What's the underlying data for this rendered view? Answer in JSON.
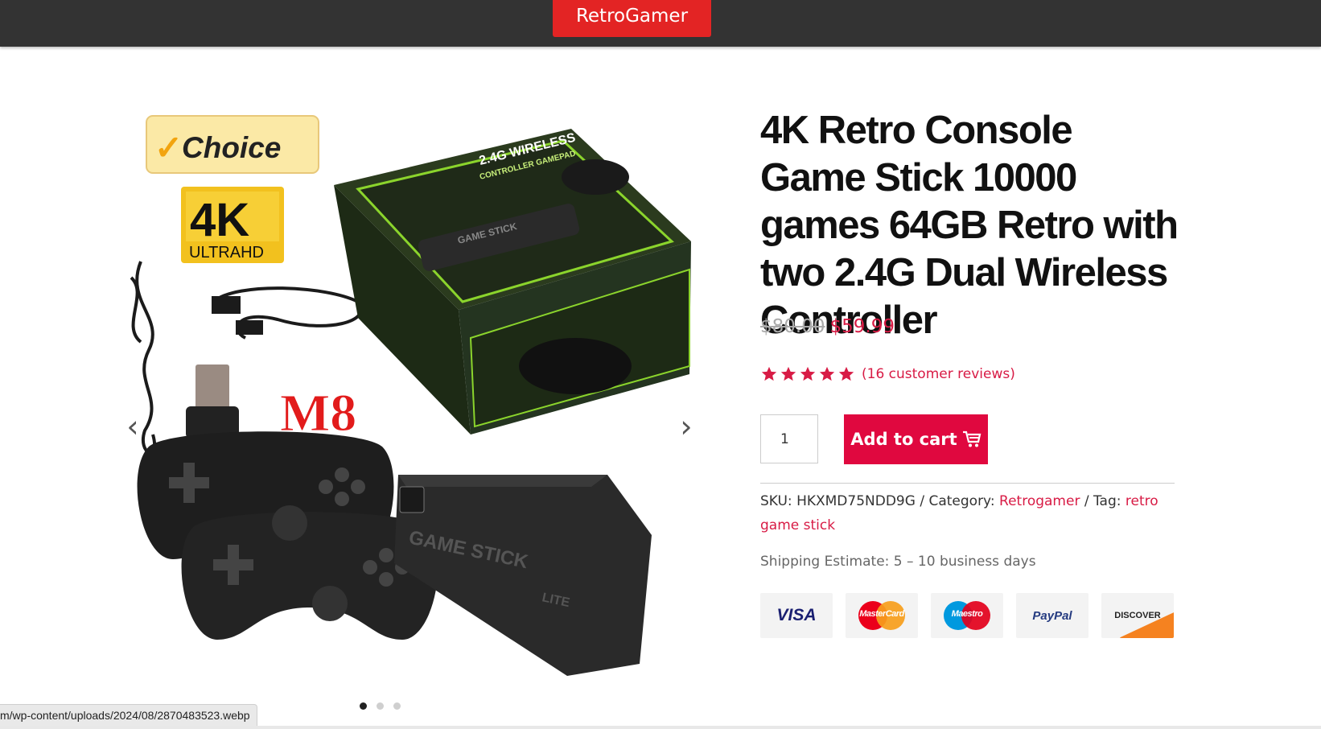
{
  "site": {
    "logo": "RetroGamer"
  },
  "gallery": {
    "image_labels": {
      "choice": "Choice",
      "k4": "4K",
      "ultrahd": "ULTRAHD",
      "model": "M8",
      "box_line1": "2.4G WIRELESS",
      "box_line2": "CONTROLLER GAMEPAD",
      "stick_text": "GAME STICK",
      "stick_sub": "LITE"
    },
    "prev_arrow": "‹",
    "next_arrow": "›",
    "slides_count": 3,
    "active_slide": 1
  },
  "status_bar": {
    "url": "m/wp-content/uploads/2024/08/2870483523.webp"
  },
  "product": {
    "title": "4K Retro Console Game Stick 10000 games 64GB Retro with two 2.4G Dual Wireless Controller",
    "old_price": "$80.00",
    "price": "$59.99",
    "rating": 5,
    "reviews_text": "(16 customer reviews)",
    "quantity": "1",
    "add_to_cart": "Add to cart",
    "sku_label": "SKU:",
    "sku": "HKXMD75NDD9G",
    "sep1": " / ",
    "category_label": "Category:",
    "category": "Retrogamer",
    "sep2": " / ",
    "tag_label": "Tag:",
    "tag": "retro game stick",
    "shipping": "Shipping Estimate: 5 – 10 business days"
  },
  "payments": {
    "visa": "VISA",
    "mastercard": "MasterCard",
    "maestro": "Maestro",
    "paypal": "PayPal",
    "discover": "DISCOVER"
  },
  "colors": {
    "accent": "#d81b45",
    "button": "#e0083f",
    "logo_bg": "#e32424",
    "topbar": "#333333"
  }
}
